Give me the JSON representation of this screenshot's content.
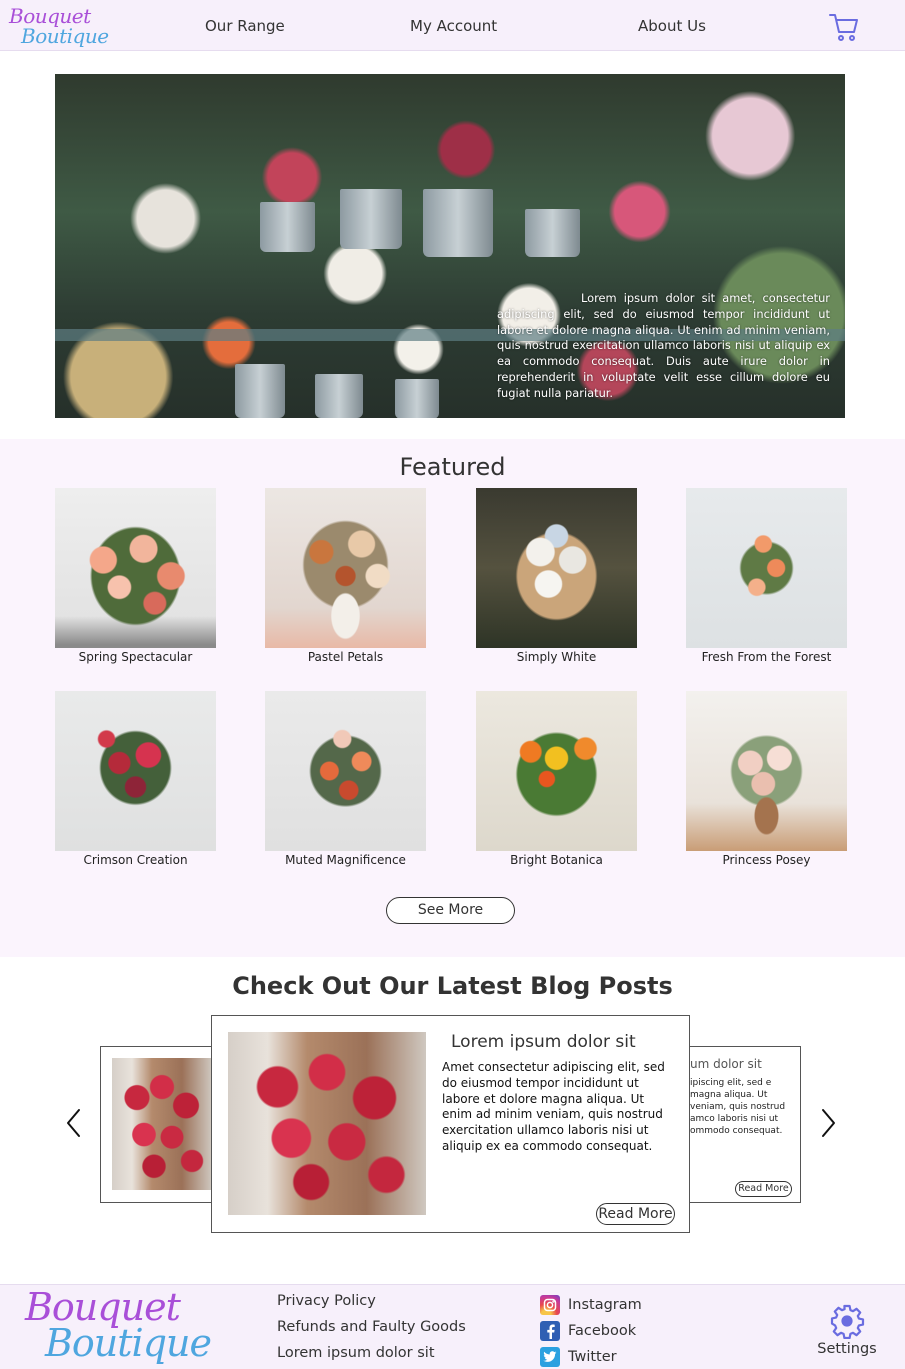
{
  "brand": {
    "line1": "Bouquet",
    "line2": "Boutique",
    "purple": "#a94fd8",
    "blue": "#4fa6df"
  },
  "nav": {
    "links": [
      "Our Range",
      "My Account",
      "About Us"
    ],
    "cart_icon": "shopping-cart-icon"
  },
  "hero": {
    "text": "Lorem ipsum dolor sit amet, consectetur adipiscing elit, sed do eiusmod tempor incididunt ut labore et dolore magna aliqua. Ut enim ad minim veniam, quis nostrud exercitation ullamco laboris nisi ut aliquip ex ea commodo consequat. Duis aute irure dolor in reprehenderit in voluptate velit esse cillum dolore eu fugiat nulla pariatur."
  },
  "featured": {
    "title": "Featured",
    "products": [
      "Spring Spectacular",
      "Pastel Petals",
      "Simply White",
      "Fresh From the Forest",
      "Crimson Creation",
      "Muted Magnificence",
      "Bright Botanica",
      "Princess Posey"
    ],
    "see_more": "See More"
  },
  "blog": {
    "title": "Check Out Our Latest Blog Posts",
    "main_post": {
      "heading": "Lorem ipsum dolor sit",
      "body": "Amet consectetur adipiscing elit, sed do eiusmod tempor incididunt ut labore et dolore magna aliqua. Ut enim ad minim veniam, quis nostrud exercitation ullamco laboris nisi ut aliquip ex ea commodo consequat.",
      "read_more": "Read More"
    },
    "side_post": {
      "heading": "um dolor sit",
      "body": "ipiscing elit, sed e magna aliqua. Ut veniam, quis nostrud amco laboris nisi ut ommodo consequat.",
      "read_more": "Read More"
    },
    "prev_icon": "chevron-left-icon",
    "next_icon": "chevron-right-icon"
  },
  "footer": {
    "links": [
      "Privacy Policy",
      "Refunds and Faulty Goods",
      "Lorem ipsum dolor sit"
    ],
    "social": [
      {
        "label": "Instagram",
        "icon": "instagram-icon",
        "color": "#d6336c"
      },
      {
        "label": "Facebook",
        "icon": "facebook-icon",
        "color": "#2f5fb3"
      },
      {
        "label": "Twitter",
        "icon": "twitter-icon",
        "color": "#2ba1e0"
      }
    ],
    "settings_label": "Settings",
    "settings_color": "#6a6ce0"
  }
}
